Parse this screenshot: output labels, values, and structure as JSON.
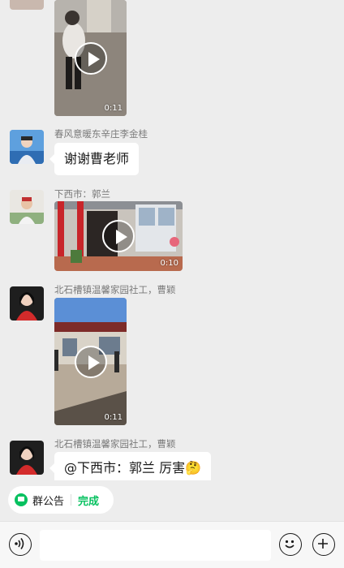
{
  "messages": [
    {
      "type": "video",
      "duration": "0:11"
    },
    {
      "type": "text",
      "sender": "春风意暖东辛庄李金桂",
      "text": "谢谢曹老师"
    },
    {
      "type": "video",
      "sender": "下西市：郭兰",
      "duration": "0:10"
    },
    {
      "type": "video",
      "sender": "北石槽镇温馨家园社工，曹颖",
      "duration": "0:11"
    },
    {
      "type": "text",
      "sender": "北石槽镇温馨家园社工，曹颖",
      "text": "@下西市：郭兰 厉害🤔"
    }
  ],
  "notice_bar": {
    "label": "群公告",
    "action": "完成",
    "icon": "notice-icon"
  },
  "input_bar": {
    "placeholder": "",
    "voice_icon": "voice-icon",
    "emoji_icon": "emoji-icon",
    "add_icon": "plus-icon"
  },
  "colors": {
    "accent": "#07c160",
    "background": "#ededed",
    "bubble": "#ffffff"
  }
}
